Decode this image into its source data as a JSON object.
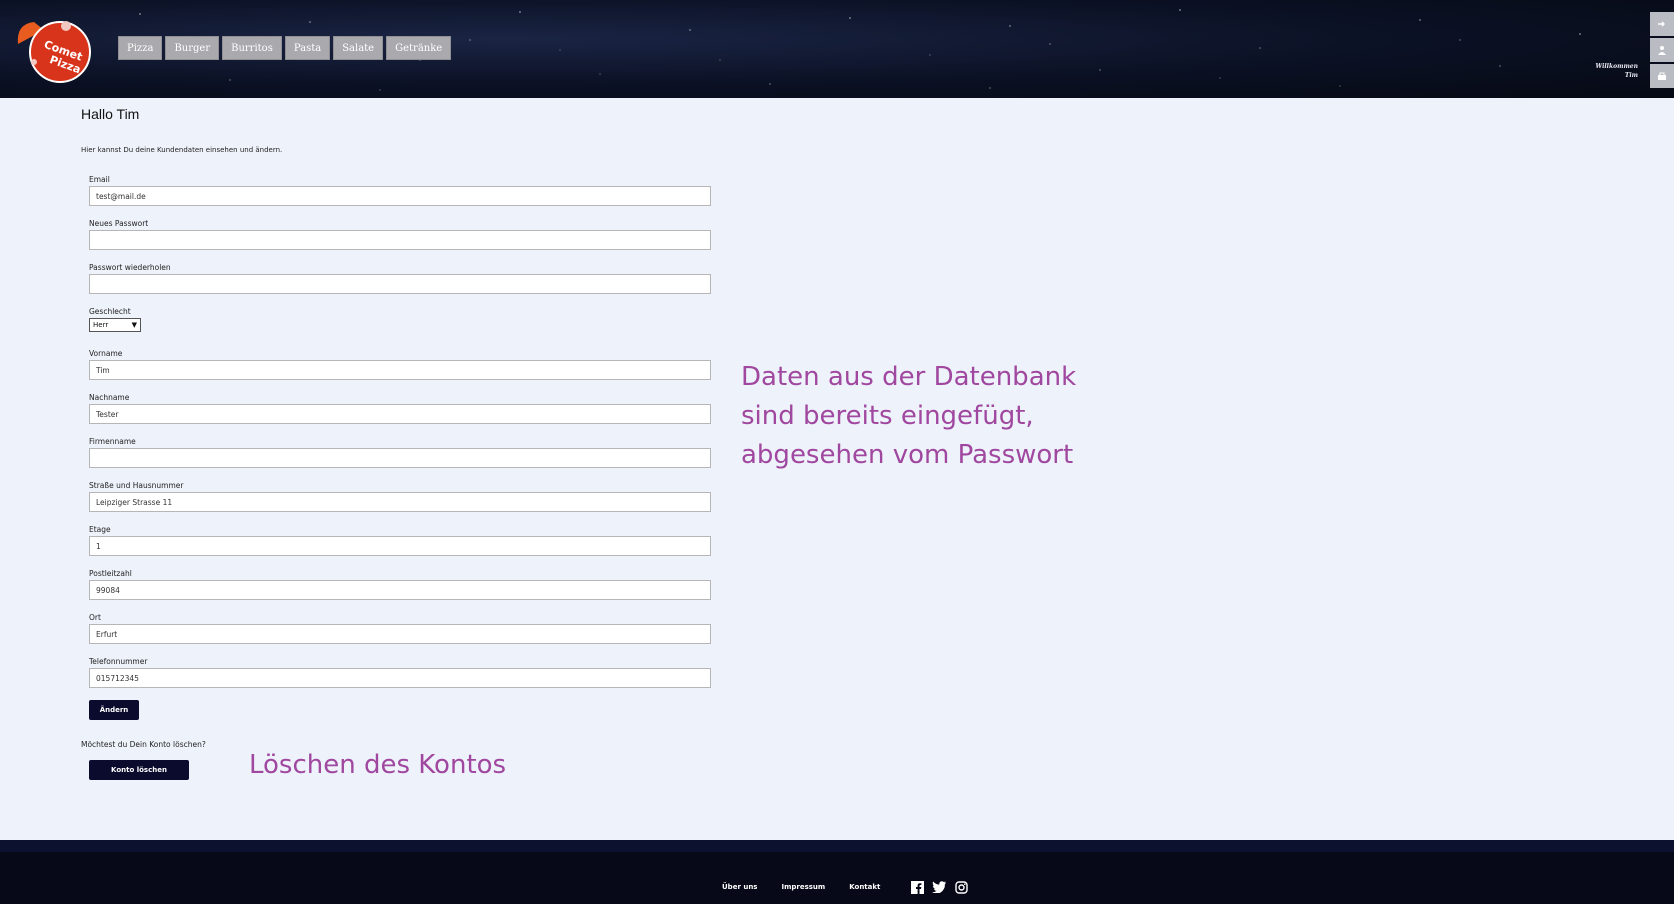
{
  "header": {
    "logo_text": "Comet Pizza",
    "nav": [
      "Pizza",
      "Burger",
      "Burritos",
      "Pasta",
      "Salate",
      "Getränke"
    ],
    "welcome_line1": "Willkommen",
    "welcome_line2": "Tim",
    "side_icons": [
      "logout-icon",
      "user-icon",
      "cart-icon"
    ]
  },
  "main": {
    "greeting": "Hallo Tim",
    "intro": "Hier kannst Du deine Kundendaten einsehen und ändern.",
    "fields": [
      {
        "label": "Email",
        "value": "test@mail.de"
      },
      {
        "label": "Neues Passwort",
        "value": ""
      },
      {
        "label": "Passwort wiederholen",
        "value": ""
      }
    ],
    "gender_label": "Geschlecht",
    "gender_value": "Herr",
    "fields2": [
      {
        "label": "Vorname",
        "value": "Tim"
      },
      {
        "label": "Nachname",
        "value": "Tester"
      },
      {
        "label": "Firmenname",
        "value": ""
      },
      {
        "label": "Straße und Hausnummer",
        "value": "Leipziger Strasse 11"
      },
      {
        "label": "Etage",
        "value": "1"
      },
      {
        "label": "Postleitzahl",
        "value": "99084"
      },
      {
        "label": "Ort",
        "value": "Erfurt"
      },
      {
        "label": "Telefonnummer",
        "value": "015712345"
      }
    ],
    "change_button": "Ändern",
    "delete_question": "Möchtest du Dein Konto löschen?",
    "delete_button": "Konto löschen"
  },
  "annotations": {
    "data_note_lines": [
      "Daten aus der Datenbank",
      "sind bereits eingefügt,",
      "abgesehen vom Passwort"
    ],
    "delete_note": "Löschen des Kontos"
  },
  "footer": {
    "links": [
      "Über uns",
      "Impressum",
      "Kontakt"
    ],
    "social": [
      "facebook-icon",
      "twitter-icon",
      "instagram-icon"
    ]
  },
  "colors": {
    "accent_annotation": "#a0479f",
    "button_dark": "#0b0b2e",
    "page_bg": "#eef3fb"
  }
}
